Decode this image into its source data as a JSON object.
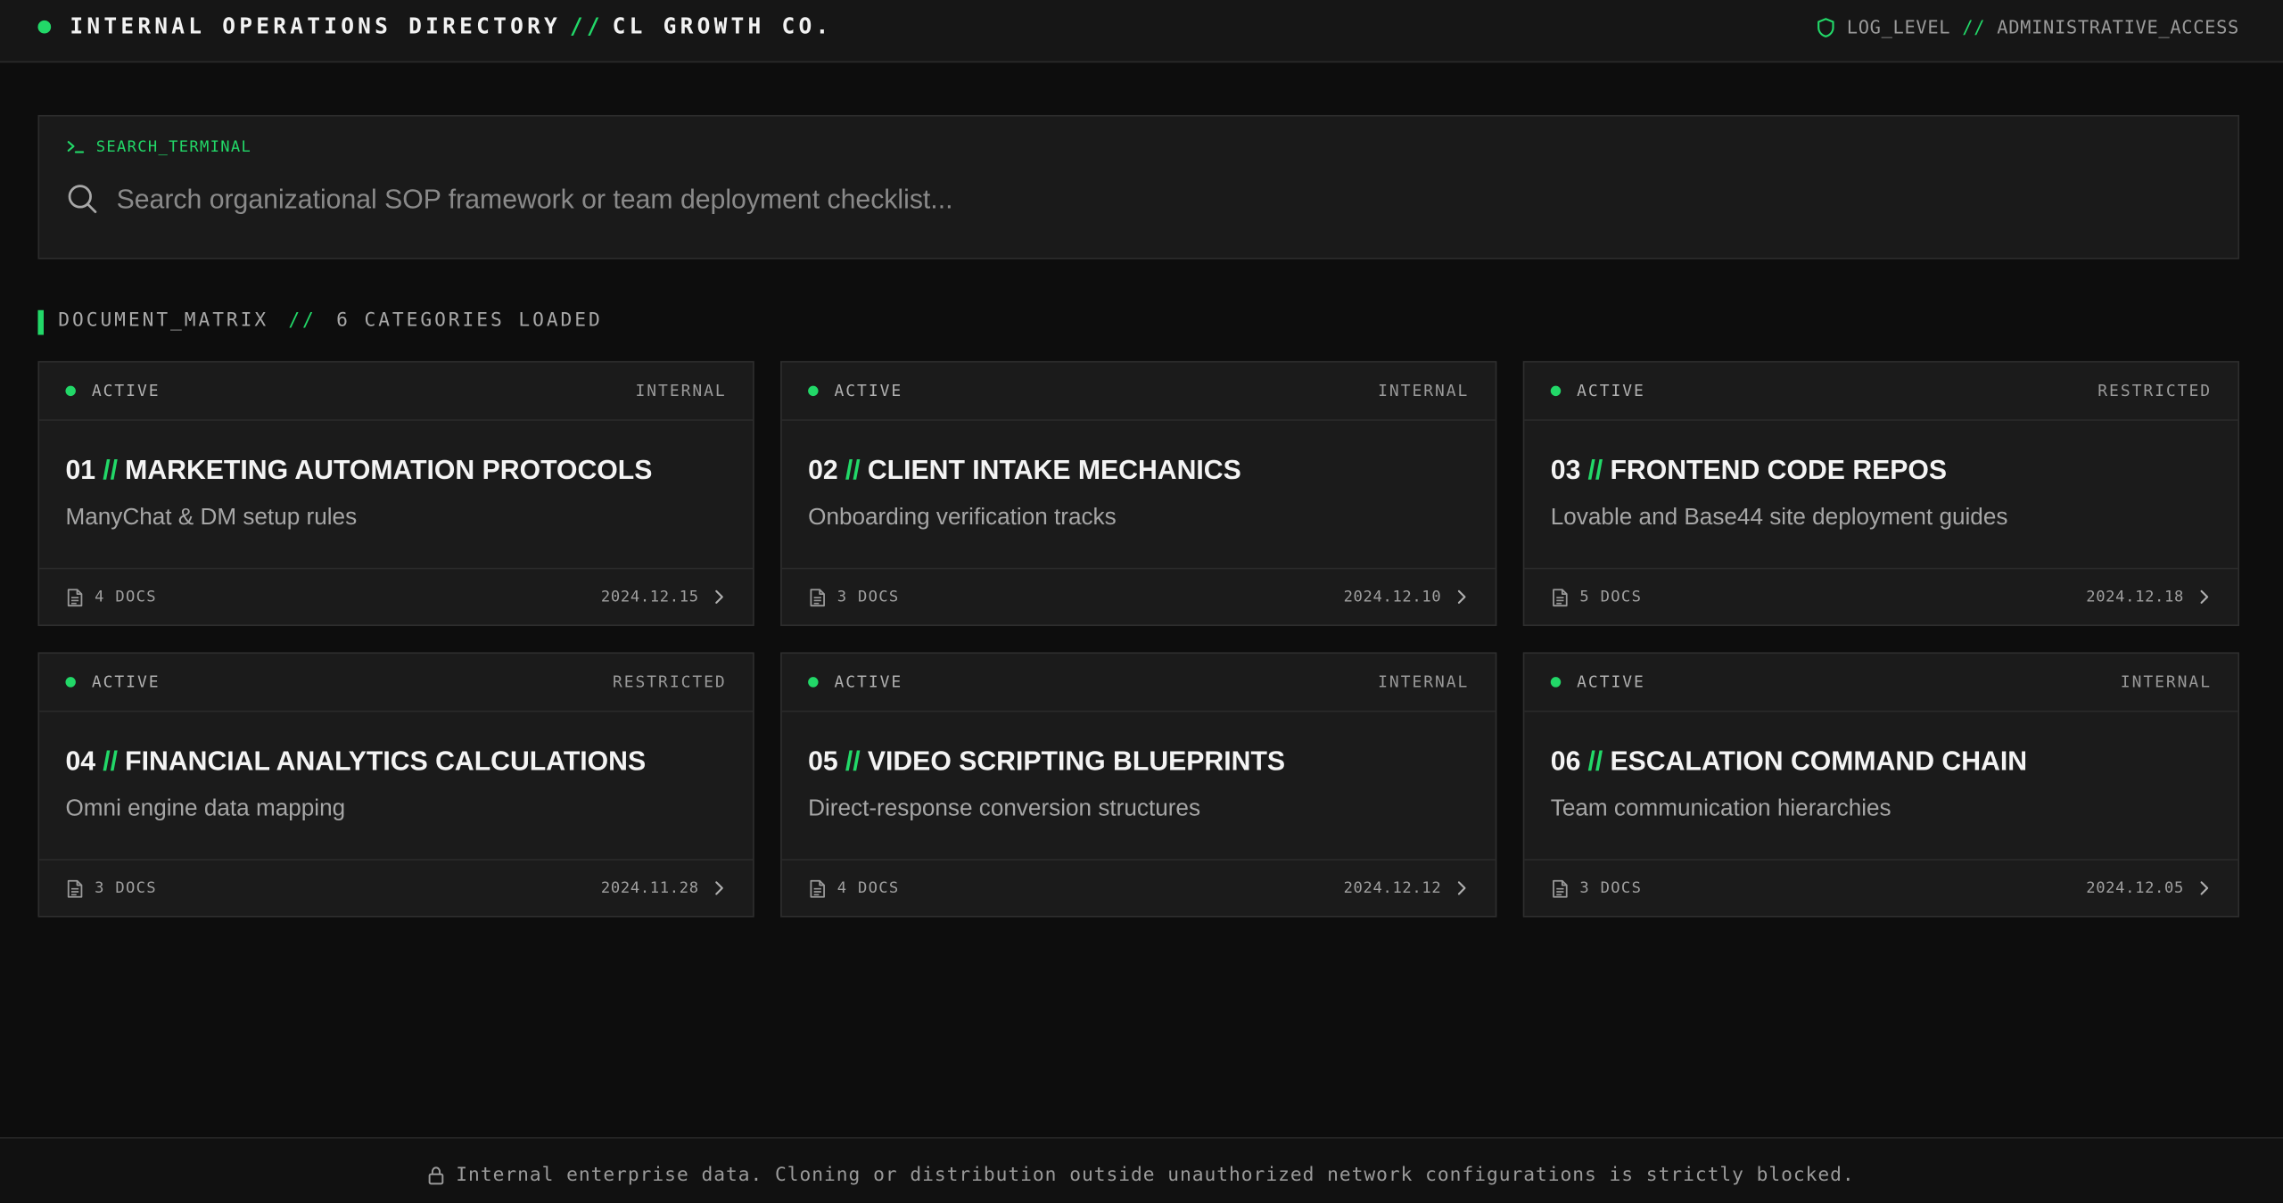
{
  "header": {
    "title": "INTERNAL OPERATIONS DIRECTORY",
    "separator": "//",
    "company": "CL GROWTH CO.",
    "log_level": "LOG_LEVEL",
    "access": "ADMINISTRATIVE_ACCESS",
    "icon": "shield-icon"
  },
  "search": {
    "label": "SEARCH_TERMINAL",
    "placeholder": "Search organizational SOP framework or team deployment checklist...",
    "value": ""
  },
  "matrix": {
    "label": "DOCUMENT_MATRIX",
    "separator": "//",
    "count_text": "6 CATEGORIES LOADED"
  },
  "cards": [
    {
      "status": "ACTIVE",
      "access": "INTERNAL",
      "number": "01",
      "title": "MARKETING AUTOMATION PROTOCOLS",
      "subtitle": "ManyChat & DM setup rules",
      "docs": "4 DOCS",
      "date": "2024.12.15"
    },
    {
      "status": "ACTIVE",
      "access": "INTERNAL",
      "number": "02",
      "title": "CLIENT INTAKE MECHANICS",
      "subtitle": "Onboarding verification tracks",
      "docs": "3 DOCS",
      "date": "2024.12.10"
    },
    {
      "status": "ACTIVE",
      "access": "RESTRICTED",
      "number": "03",
      "title": "FRONTEND CODE REPOS",
      "subtitle": "Lovable and Base44 site deployment guides",
      "docs": "5 DOCS",
      "date": "2024.12.18"
    },
    {
      "status": "ACTIVE",
      "access": "RESTRICTED",
      "number": "04",
      "title": "FINANCIAL ANALYTICS CALCULATIONS",
      "subtitle": "Omni engine data mapping",
      "docs": "3 DOCS",
      "date": "2024.11.28"
    },
    {
      "status": "ACTIVE",
      "access": "INTERNAL",
      "number": "05",
      "title": "VIDEO SCRIPTING BLUEPRINTS",
      "subtitle": "Direct-response conversion structures",
      "docs": "4 DOCS",
      "date": "2024.12.12"
    },
    {
      "status": "ACTIVE",
      "access": "INTERNAL",
      "number": "06",
      "title": "ESCALATION COMMAND CHAIN",
      "subtitle": "Team communication hierarchies",
      "docs": "3 DOCS",
      "date": "2024.12.05"
    }
  ],
  "card_separator": "//",
  "footer": {
    "text": "Internal enterprise data. Cloning or distribution outside unauthorized network configurations is strictly blocked.",
    "icon": "lock-icon"
  },
  "colors": {
    "accent": "#22d868",
    "background": "#0d0d0d",
    "card": "#1b1b1b"
  }
}
